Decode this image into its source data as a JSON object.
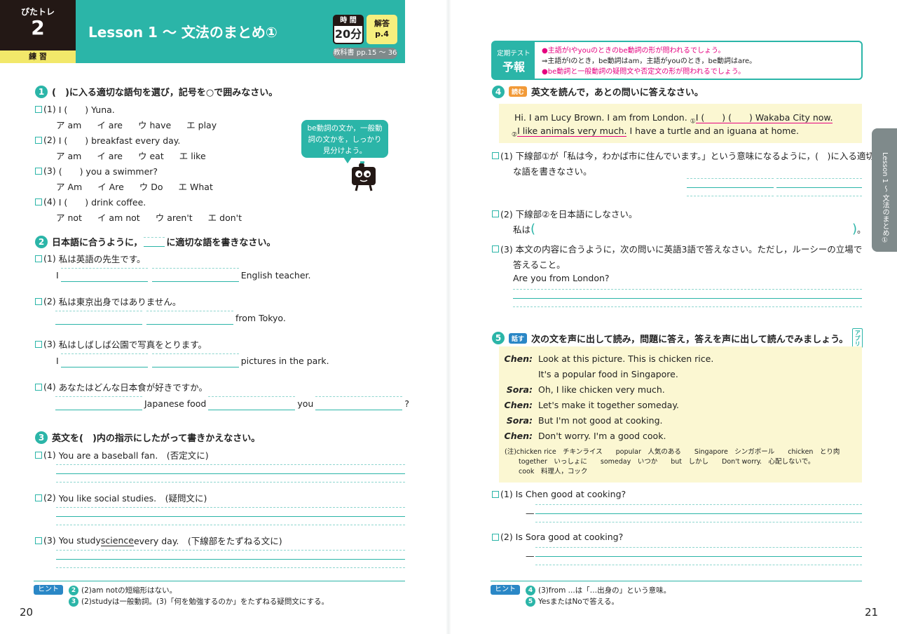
{
  "left": {
    "badge": {
      "top": "ぴたトレ",
      "num": "2",
      "bottom": "練 習"
    },
    "title": "Lesson 1 ～ 文法のまとめ①",
    "time_label": "時 間",
    "time_value": "20分",
    "answer_label": "解答",
    "answer_page": "p.4",
    "textbook": "教科書 pp.15 ～ 36",
    "bubble": "be動詞の文か，一般動詞の文かを，しっかり見分けよう。",
    "q1": {
      "num": "1",
      "title": "(　)に入る適切な語句を選び，記号を○で囲みなさい。",
      "items": [
        {
          "n": "(1)",
          "text": "I (　　) Yuna.",
          "choices": [
            "ア am",
            "イ are",
            "ウ have",
            "エ play"
          ]
        },
        {
          "n": "(2)",
          "text": "I (　　) breakfast every day.",
          "choices": [
            "ア am",
            "イ are",
            "ウ eat",
            "エ like"
          ]
        },
        {
          "n": "(3)",
          "text": "(　　) you a swimmer?",
          "choices": [
            "ア Am",
            "イ Are",
            "ウ Do",
            "エ What"
          ]
        },
        {
          "n": "(4)",
          "text": "I (　　) drink coffee.",
          "choices": [
            "ア not",
            "イ am not",
            "ウ aren't",
            "エ don't"
          ]
        }
      ]
    },
    "q2": {
      "num": "2",
      "title_a": "日本語に合うように，",
      "title_b": "に適切な語を書きなさい。",
      "items": [
        {
          "n": "(1)",
          "jp": "私は英語の先生です。",
          "pre": "I",
          "post": "English teacher."
        },
        {
          "n": "(2)",
          "jp": "私は東京出身ではありません。",
          "post": "from Tokyo."
        },
        {
          "n": "(3)",
          "jp": "私はしばしば公園で写真をとります。",
          "pre": "I",
          "post": "pictures in the park."
        },
        {
          "n": "(4)",
          "jp": "あなたはどんな日本食が好きですか。",
          "mid1": "Japanese food",
          "mid2": "you",
          "end": "?"
        }
      ]
    },
    "q3": {
      "num": "3",
      "title": "英文を(　)内の指示にしたがって書きかえなさい。",
      "items": [
        {
          "n": "(1)",
          "text": "You are a baseball fan.　(否定文に)"
        },
        {
          "n": "(2)",
          "text": "You like social studies.　(疑問文に)"
        },
        {
          "n": "(3)",
          "pre": "You study ",
          "u": "science",
          "post": " every day.　(下線部をたずねる文に)"
        }
      ]
    },
    "hint_label": "ヒント",
    "hints": [
      {
        "num": "2",
        "text": "(2)am notの短縮形はない。"
      },
      {
        "num": "3",
        "text": "(2)studyは一般動詞。(3)「何を勉強するのか」をたずねる疑問文にする。"
      }
    ],
    "page_num": "20"
  },
  "right": {
    "forecast": {
      "l1": "定期テスト",
      "l2": "予報",
      "lines": [
        "●主語がIやyouのときのbe動詞の形が問われるでしょう。",
        "⇒主語がIのとき，be動詞はam，主語がyouのとき，be動詞はare。",
        "●be動詞と一般動詞の疑問文や否定文の形が問われるでしょう。"
      ]
    },
    "q4": {
      "num": "4",
      "tag": "読む",
      "title": "英文を読んで，あとの問いに答えなさい。",
      "passage_a": "Hi.  I am Lucy Brown.  I am from London.  ",
      "passage_u1": "I (　　) (　　) Wakaba City now.",
      "passage_u2": "I like animals very much.",
      "passage_b": "  I have a turtle and an iguana at home.",
      "mark1": "①",
      "mark2": "②",
      "q1": "(1) 下線部①が「私は今，わかば市に住んでいます。」という意味になるように，(　)に入る適切",
      "q1b": "な語を書きなさい。",
      "q2": "(2) 下線部②を日本語にしなさい。",
      "q2_pre": "私は",
      "q2_post": "。",
      "q3": "(3) 本文の内容に合うように，次の問いに英語3語で答えなさい。ただし，ルーシーの立場で",
      "q3b": "答えること。",
      "q3c": "Are you from London?"
    },
    "q5": {
      "num": "5",
      "tag": "話す",
      "title": "次の文を声に出して読み，問題に答え，答えを声に出して読んでみましょう。",
      "app": "アプリ",
      "dialog": [
        {
          "spk": "Chen:",
          "text": "Look at this picture.  This is chicken rice."
        },
        {
          "spk": "",
          "text": "It's a popular food in Singapore."
        },
        {
          "spk": "Sora:",
          "text": "Oh, I like chicken very much."
        },
        {
          "spk": "Chen:",
          "text": "Let's make it together someday."
        },
        {
          "spk": "Sora:",
          "text": "But I'm not good at cooking."
        },
        {
          "spk": "Chen:",
          "text": "Don't worry.  I'm a good cook."
        }
      ],
      "notes": [
        "(注)chicken rice　チキンライス　　popular　人気のある　　Singapore　シンガポール　　chicken　とり肉",
        "together　いっしょに　　someday　いつか　　but　しかし　　Don't worry.　心配しないで。",
        "cook　料理人，コック"
      ],
      "q1": "(1) Is Chen good at cooking?",
      "q2": "(2) Is Sora good at cooking?",
      "dash": "—"
    },
    "side_tab": "Lesson 1 ～ 文法のまとめ①",
    "hint_label": "ヒント",
    "hints": [
      {
        "num": "4",
        "text": "(3)from ...は「…出身の」という意味。"
      },
      {
        "num": "5",
        "text": "YesまたはNoで答える。"
      }
    ],
    "page_num": "21"
  }
}
